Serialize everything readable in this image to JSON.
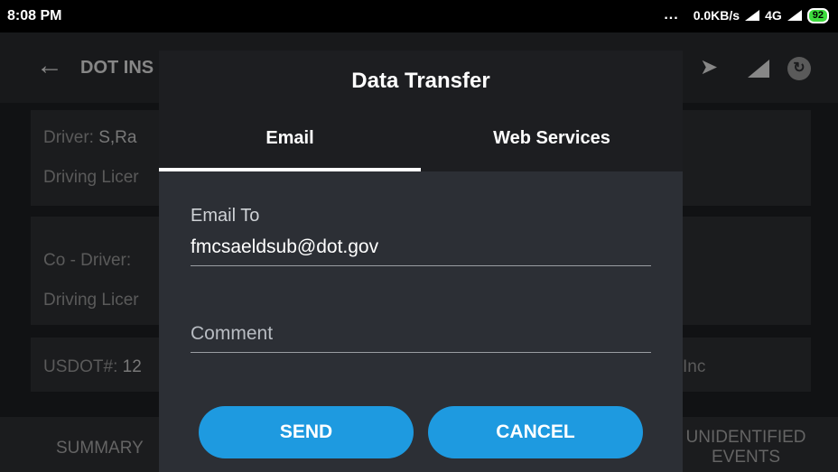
{
  "status_bar": {
    "time": "8:08 PM",
    "dots": "...",
    "net_speed": "0.0KB/s",
    "network": "4G",
    "battery": "92"
  },
  "app_bar": {
    "title": "DOT INS",
    "back_icon": "arrow-left-icon",
    "actions": [
      "send-icon",
      "signal-icon",
      "sync-icon"
    ]
  },
  "background": {
    "driver_label": "Driver:",
    "driver_value": "S,Ra",
    "driving_licence_1": "Driving Licer",
    "co_driver_label": "Co - Driver:",
    "driving_licence_2": "Driving Licer",
    "usdot_label": "USDOT#:",
    "usdot_value": "12",
    "carrier_suffix": "Inc",
    "bottom_tabs": [
      "SUMMARY",
      "UNIDENTIFIED EVENTS"
    ]
  },
  "dialog": {
    "title": "Data Transfer",
    "tabs": [
      {
        "label": "Email",
        "active": true
      },
      {
        "label": "Web Services",
        "active": false
      }
    ],
    "email_to_label": "Email To",
    "email_to_value": "fmcsaeldsub@dot.gov",
    "comment_placeholder": "Comment",
    "comment_value": "",
    "send_label": "SEND",
    "cancel_label": "CANCEL",
    "accent_color": "#1e9ae0"
  }
}
